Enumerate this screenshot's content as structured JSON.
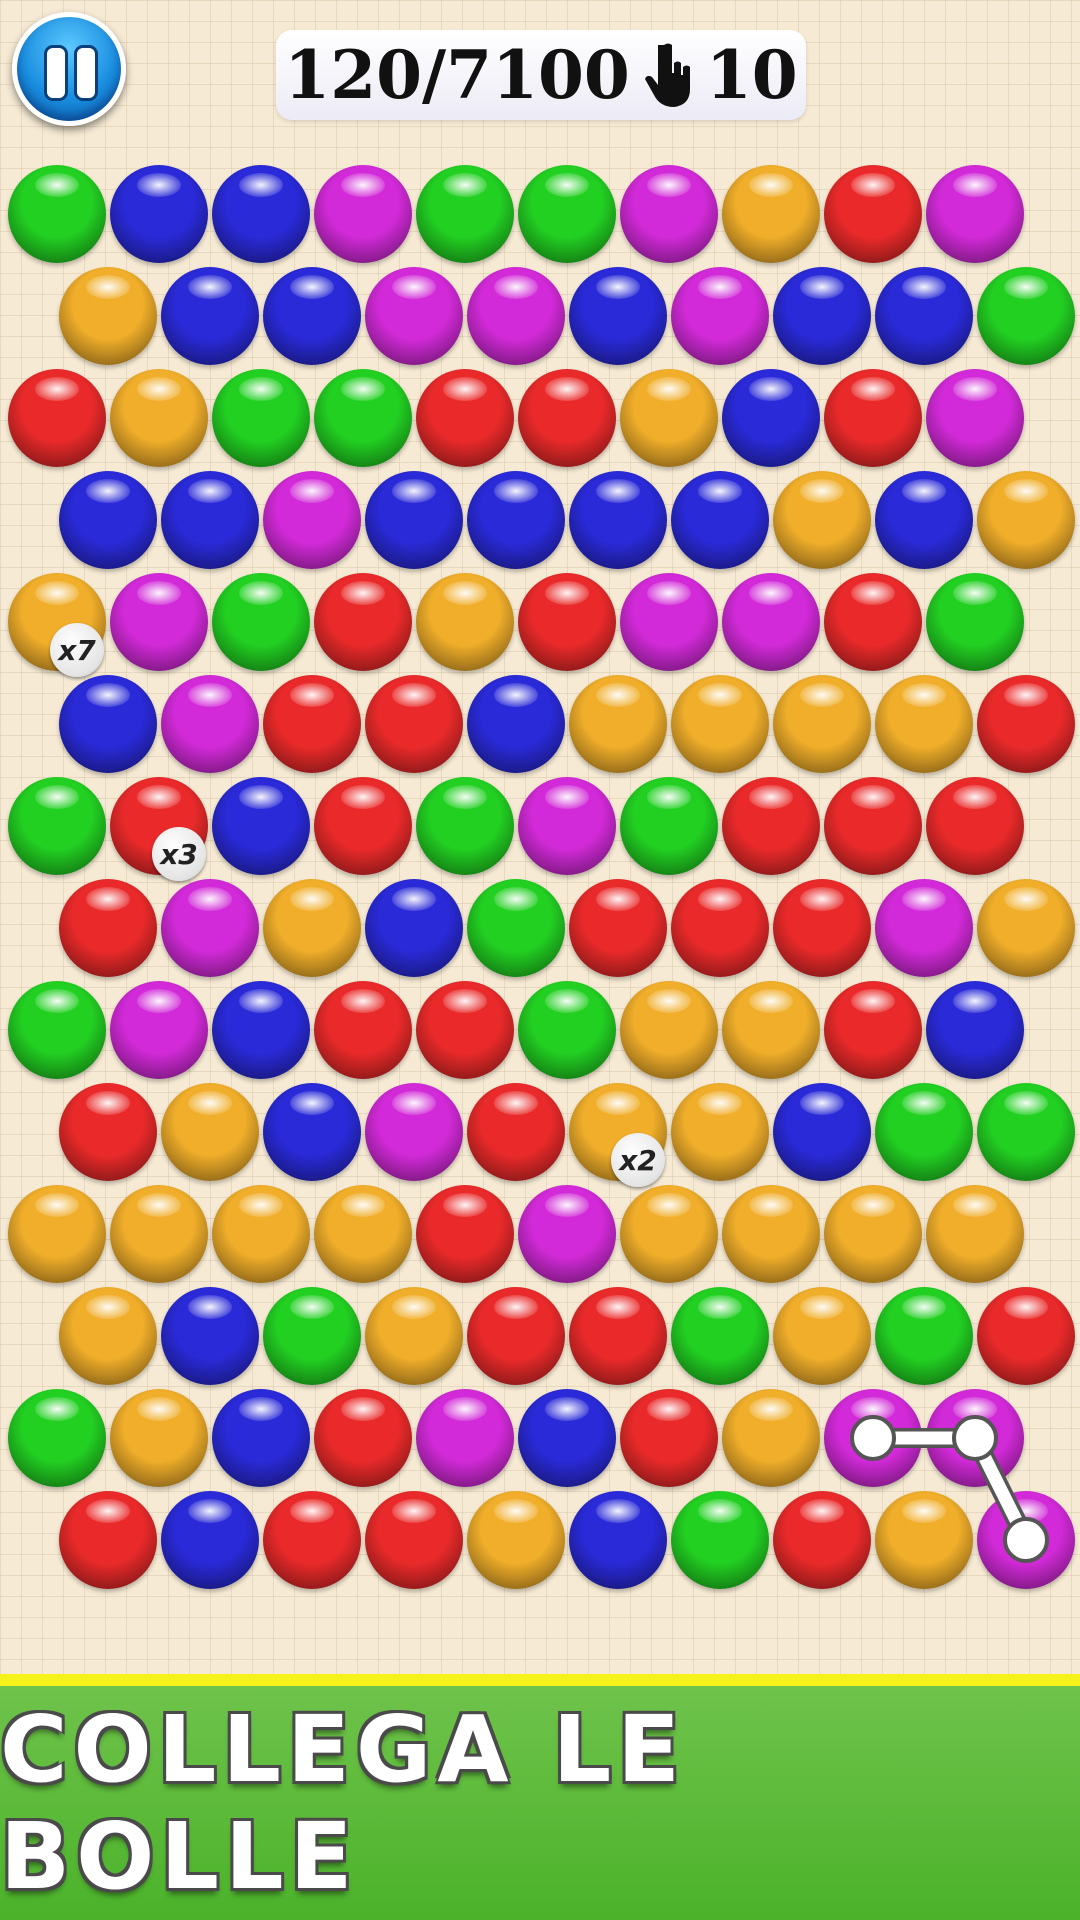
{
  "hud": {
    "score": "120/7100",
    "moves_icon": "hand-icon",
    "moves": "10",
    "pause_icon": "pause-icon"
  },
  "colors": {
    "G": "#22d022",
    "B": "#2a2ad8",
    "M": "#d22ad8",
    "Y": "#f0ae2a",
    "R": "#ea2a2a"
  },
  "board": {
    "rows": [
      "GBBMGGMYRM",
      "YBBMMBMBBG",
      "RYGGRRYBRM",
      "BBMBBBBYBY",
      "YMGRYRMMRG",
      "BMRRBYYYYR",
      "GRBRGMGRRR",
      "RMYBGRRRMY",
      "GMBRRGYYRB",
      "RYBMRYYBGG",
      "YYYYRMYYYY",
      "YBGYRRGYGR",
      "GYBRMBRYMM",
      "RBRRYBGRYM"
    ],
    "multipliers": [
      {
        "row": 4,
        "col": 0,
        "label": "x7"
      },
      {
        "row": 6,
        "col": 1,
        "label": "x3"
      },
      {
        "row": 9,
        "col": 5,
        "label": "x2"
      }
    ],
    "selected_path": [
      {
        "row": 12,
        "col": 8
      },
      {
        "row": 12,
        "col": 9
      },
      {
        "row": 13,
        "col": 9
      }
    ]
  },
  "banner": {
    "title": "COLLEGA LE BOLLE"
  }
}
